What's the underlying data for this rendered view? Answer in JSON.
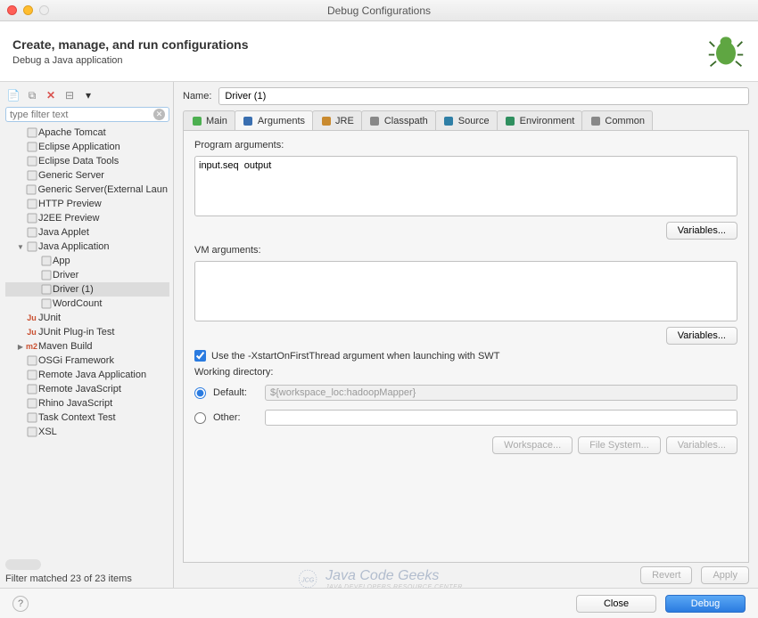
{
  "window": {
    "title": "Debug Configurations"
  },
  "header": {
    "title": "Create, manage, and run configurations",
    "subtitle": "Debug a Java application"
  },
  "toolbar": {
    "new_tip": "New",
    "dup_tip": "Duplicate",
    "del_tip": "Delete",
    "col_tip": "Collapse",
    "filter_tip": "Filter"
  },
  "filter": {
    "placeholder": "type filter text"
  },
  "tree": {
    "items": [
      {
        "label": "Apache Tomcat",
        "indent": 1
      },
      {
        "label": "Eclipse Application",
        "indent": 1
      },
      {
        "label": "Eclipse Data Tools",
        "indent": 1
      },
      {
        "label": "Generic Server",
        "indent": 1
      },
      {
        "label": "Generic Server(External Laun",
        "indent": 1
      },
      {
        "label": "HTTP Preview",
        "indent": 1
      },
      {
        "label": "J2EE Preview",
        "indent": 1
      },
      {
        "label": "Java Applet",
        "indent": 1
      },
      {
        "label": "Java Application",
        "indent": 1,
        "tw": "▼"
      },
      {
        "label": "App",
        "indent": 2
      },
      {
        "label": "Driver",
        "indent": 2
      },
      {
        "label": "Driver (1)",
        "indent": 2,
        "sel": true
      },
      {
        "label": "WordCount",
        "indent": 2
      },
      {
        "label": "JUnit",
        "indent": 1,
        "ic": "Ju",
        "col": "#c94f2f"
      },
      {
        "label": "JUnit Plug-in Test",
        "indent": 1,
        "ic": "Ju",
        "col": "#c94f2f"
      },
      {
        "label": "Maven Build",
        "indent": 1,
        "tw": "▶",
        "ic": "m2",
        "col": "#c94f2f"
      },
      {
        "label": "OSGi Framework",
        "indent": 1
      },
      {
        "label": "Remote Java Application",
        "indent": 1
      },
      {
        "label": "Remote JavaScript",
        "indent": 1
      },
      {
        "label": "Rhino JavaScript",
        "indent": 1
      },
      {
        "label": "Task Context Test",
        "indent": 1
      },
      {
        "label": "XSL",
        "indent": 1
      }
    ]
  },
  "filter_status": "Filter matched 23 of 23 items",
  "name_field": {
    "label": "Name:",
    "value": "Driver (1)"
  },
  "tabs": [
    {
      "label": "Main",
      "id": "tab-main"
    },
    {
      "label": "Arguments",
      "id": "tab-arguments",
      "active": true
    },
    {
      "label": "JRE",
      "id": "tab-jre"
    },
    {
      "label": "Classpath",
      "id": "tab-classpath"
    },
    {
      "label": "Source",
      "id": "tab-source"
    },
    {
      "label": "Environment",
      "id": "tab-environment"
    },
    {
      "label": "Common",
      "id": "tab-common"
    }
  ],
  "arguments": {
    "program_label": "Program arguments:",
    "program_value": "input.seq  output",
    "vm_label": "VM arguments:",
    "vm_value": "",
    "variables_btn": "Variables...",
    "swt_check_label": "Use the -XstartOnFirstThread argument when launching with SWT",
    "swt_checked": true,
    "wd_label": "Working directory:",
    "default_label": "Default:",
    "default_value": "${workspace_loc:hadoopMapper}",
    "other_label": "Other:",
    "workspace_btn": "Workspace...",
    "filesystem_btn": "File System...",
    "vars_btn": "Variables..."
  },
  "footer": {
    "revert": "Revert",
    "apply": "Apply"
  },
  "bottom": {
    "close": "Close",
    "debug": "Debug"
  },
  "watermark": {
    "brand": "Java Code Geeks",
    "tag": "JAVA DEVELOPERS RESOURCE CENTER"
  }
}
